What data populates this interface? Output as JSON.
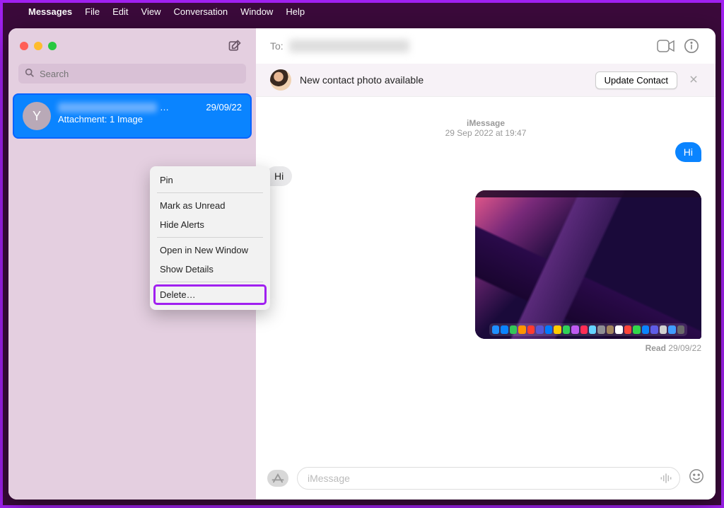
{
  "menubar": {
    "app": "Messages",
    "items": [
      "File",
      "Edit",
      "View",
      "Conversation",
      "Window",
      "Help"
    ]
  },
  "sidebar": {
    "search_placeholder": "Search",
    "conversation": {
      "avatar_initial": "Y",
      "name_truncation": "…",
      "date": "29/09/22",
      "preview": "Attachment: 1 Image"
    }
  },
  "context_menu": {
    "pin": "Pin",
    "mark_unread": "Mark as Unread",
    "hide_alerts": "Hide Alerts",
    "open_new_window": "Open in New Window",
    "show_details": "Show Details",
    "delete": "Delete…"
  },
  "header": {
    "to_label": "To:"
  },
  "banner": {
    "text": "New contact photo available",
    "button": "Update Contact"
  },
  "thread": {
    "service": "iMessage",
    "timestamp": "29 Sep 2022 at 19:47",
    "outgoing1": "Hi",
    "incoming1": "Hi",
    "receipt_label": "Read",
    "receipt_date": "29/09/22"
  },
  "composer": {
    "placeholder": "iMessage",
    "apps_label": ""
  },
  "dock_colors": [
    "#1e90ff",
    "#0a84ff",
    "#34c759",
    "#ff9500",
    "#ff3b30",
    "#5856d6",
    "#007aff",
    "#ffcc00",
    "#30d158",
    "#bf5af2",
    "#ff2d55",
    "#64d2ff",
    "#8e8e93",
    "#a2845e",
    "#ffffff",
    "#ff453a",
    "#32d74b",
    "#0a84ff",
    "#5e5ce6",
    "#d0d0d0",
    "#409cff",
    "#6a6a6a"
  ]
}
